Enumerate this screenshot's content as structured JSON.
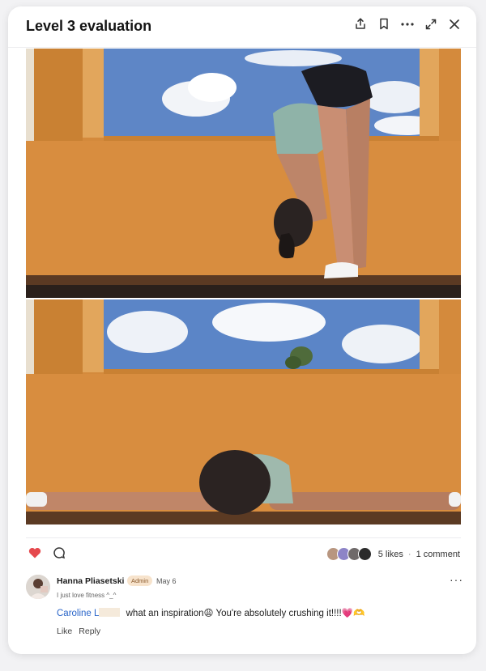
{
  "post": {
    "title": "Level 3 evaluation",
    "header_icons": [
      "share-icon",
      "bookmark-icon",
      "more-icon",
      "expand-icon",
      "close-icon"
    ]
  },
  "engagement": {
    "liked": true,
    "likes_label": "5 likes",
    "separator": "·",
    "comments_label": "1 comment",
    "accent_like": "#e5484d"
  },
  "comment": {
    "author": "Hanna Pliasetski",
    "role_badge": "Admin",
    "date": "May 6",
    "bio": "I just love fitness ^_^",
    "mention": "Caroline L",
    "text": " what an inspiration😩 You're absolutely crushing it!!!!💗🫶",
    "like_label": "Like",
    "reply_label": "Reply",
    "mention_color": "#2b66c9"
  }
}
